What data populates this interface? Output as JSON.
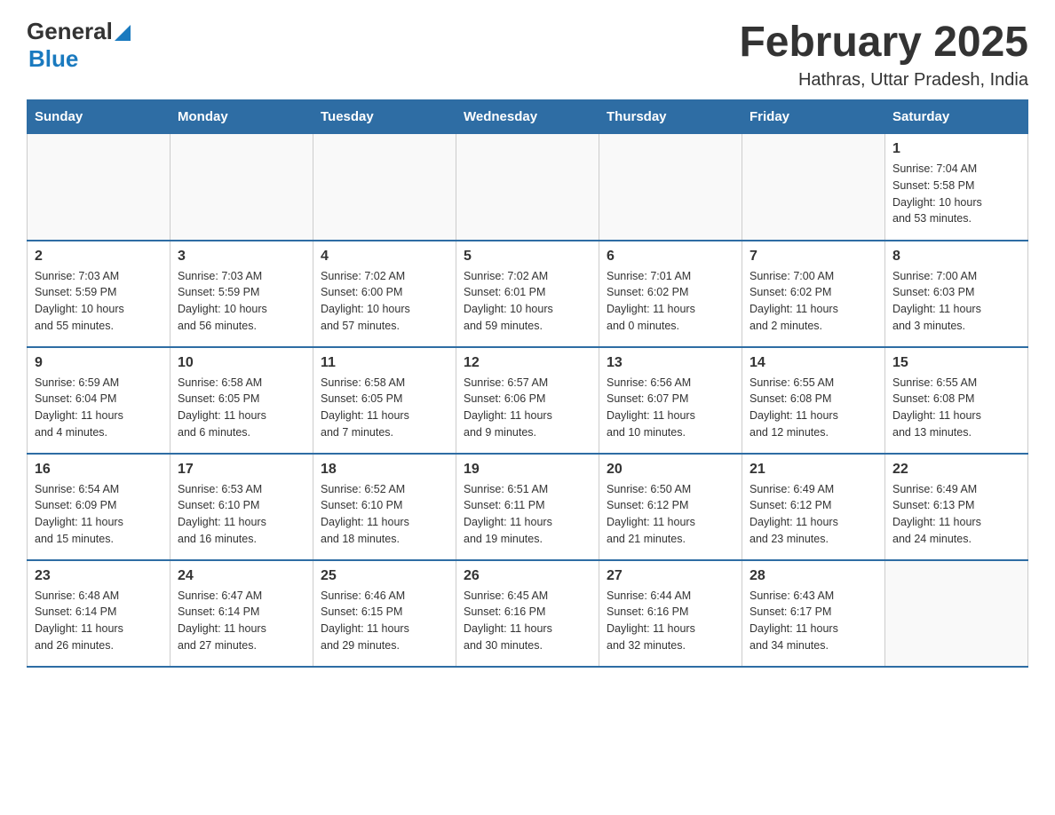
{
  "header": {
    "logo_general": "General",
    "logo_blue": "Blue",
    "title": "February 2025",
    "subtitle": "Hathras, Uttar Pradesh, India"
  },
  "weekdays": [
    "Sunday",
    "Monday",
    "Tuesday",
    "Wednesday",
    "Thursday",
    "Friday",
    "Saturday"
  ],
  "weeks": [
    [
      {
        "day": "",
        "info": ""
      },
      {
        "day": "",
        "info": ""
      },
      {
        "day": "",
        "info": ""
      },
      {
        "day": "",
        "info": ""
      },
      {
        "day": "",
        "info": ""
      },
      {
        "day": "",
        "info": ""
      },
      {
        "day": "1",
        "info": "Sunrise: 7:04 AM\nSunset: 5:58 PM\nDaylight: 10 hours\nand 53 minutes."
      }
    ],
    [
      {
        "day": "2",
        "info": "Sunrise: 7:03 AM\nSunset: 5:59 PM\nDaylight: 10 hours\nand 55 minutes."
      },
      {
        "day": "3",
        "info": "Sunrise: 7:03 AM\nSunset: 5:59 PM\nDaylight: 10 hours\nand 56 minutes."
      },
      {
        "day": "4",
        "info": "Sunrise: 7:02 AM\nSunset: 6:00 PM\nDaylight: 10 hours\nand 57 minutes."
      },
      {
        "day": "5",
        "info": "Sunrise: 7:02 AM\nSunset: 6:01 PM\nDaylight: 10 hours\nand 59 minutes."
      },
      {
        "day": "6",
        "info": "Sunrise: 7:01 AM\nSunset: 6:02 PM\nDaylight: 11 hours\nand 0 minutes."
      },
      {
        "day": "7",
        "info": "Sunrise: 7:00 AM\nSunset: 6:02 PM\nDaylight: 11 hours\nand 2 minutes."
      },
      {
        "day": "8",
        "info": "Sunrise: 7:00 AM\nSunset: 6:03 PM\nDaylight: 11 hours\nand 3 minutes."
      }
    ],
    [
      {
        "day": "9",
        "info": "Sunrise: 6:59 AM\nSunset: 6:04 PM\nDaylight: 11 hours\nand 4 minutes."
      },
      {
        "day": "10",
        "info": "Sunrise: 6:58 AM\nSunset: 6:05 PM\nDaylight: 11 hours\nand 6 minutes."
      },
      {
        "day": "11",
        "info": "Sunrise: 6:58 AM\nSunset: 6:05 PM\nDaylight: 11 hours\nand 7 minutes."
      },
      {
        "day": "12",
        "info": "Sunrise: 6:57 AM\nSunset: 6:06 PM\nDaylight: 11 hours\nand 9 minutes."
      },
      {
        "day": "13",
        "info": "Sunrise: 6:56 AM\nSunset: 6:07 PM\nDaylight: 11 hours\nand 10 minutes."
      },
      {
        "day": "14",
        "info": "Sunrise: 6:55 AM\nSunset: 6:08 PM\nDaylight: 11 hours\nand 12 minutes."
      },
      {
        "day": "15",
        "info": "Sunrise: 6:55 AM\nSunset: 6:08 PM\nDaylight: 11 hours\nand 13 minutes."
      }
    ],
    [
      {
        "day": "16",
        "info": "Sunrise: 6:54 AM\nSunset: 6:09 PM\nDaylight: 11 hours\nand 15 minutes."
      },
      {
        "day": "17",
        "info": "Sunrise: 6:53 AM\nSunset: 6:10 PM\nDaylight: 11 hours\nand 16 minutes."
      },
      {
        "day": "18",
        "info": "Sunrise: 6:52 AM\nSunset: 6:10 PM\nDaylight: 11 hours\nand 18 minutes."
      },
      {
        "day": "19",
        "info": "Sunrise: 6:51 AM\nSunset: 6:11 PM\nDaylight: 11 hours\nand 19 minutes."
      },
      {
        "day": "20",
        "info": "Sunrise: 6:50 AM\nSunset: 6:12 PM\nDaylight: 11 hours\nand 21 minutes."
      },
      {
        "day": "21",
        "info": "Sunrise: 6:49 AM\nSunset: 6:12 PM\nDaylight: 11 hours\nand 23 minutes."
      },
      {
        "day": "22",
        "info": "Sunrise: 6:49 AM\nSunset: 6:13 PM\nDaylight: 11 hours\nand 24 minutes."
      }
    ],
    [
      {
        "day": "23",
        "info": "Sunrise: 6:48 AM\nSunset: 6:14 PM\nDaylight: 11 hours\nand 26 minutes."
      },
      {
        "day": "24",
        "info": "Sunrise: 6:47 AM\nSunset: 6:14 PM\nDaylight: 11 hours\nand 27 minutes."
      },
      {
        "day": "25",
        "info": "Sunrise: 6:46 AM\nSunset: 6:15 PM\nDaylight: 11 hours\nand 29 minutes."
      },
      {
        "day": "26",
        "info": "Sunrise: 6:45 AM\nSunset: 6:16 PM\nDaylight: 11 hours\nand 30 minutes."
      },
      {
        "day": "27",
        "info": "Sunrise: 6:44 AM\nSunset: 6:16 PM\nDaylight: 11 hours\nand 32 minutes."
      },
      {
        "day": "28",
        "info": "Sunrise: 6:43 AM\nSunset: 6:17 PM\nDaylight: 11 hours\nand 34 minutes."
      },
      {
        "day": "",
        "info": ""
      }
    ]
  ]
}
